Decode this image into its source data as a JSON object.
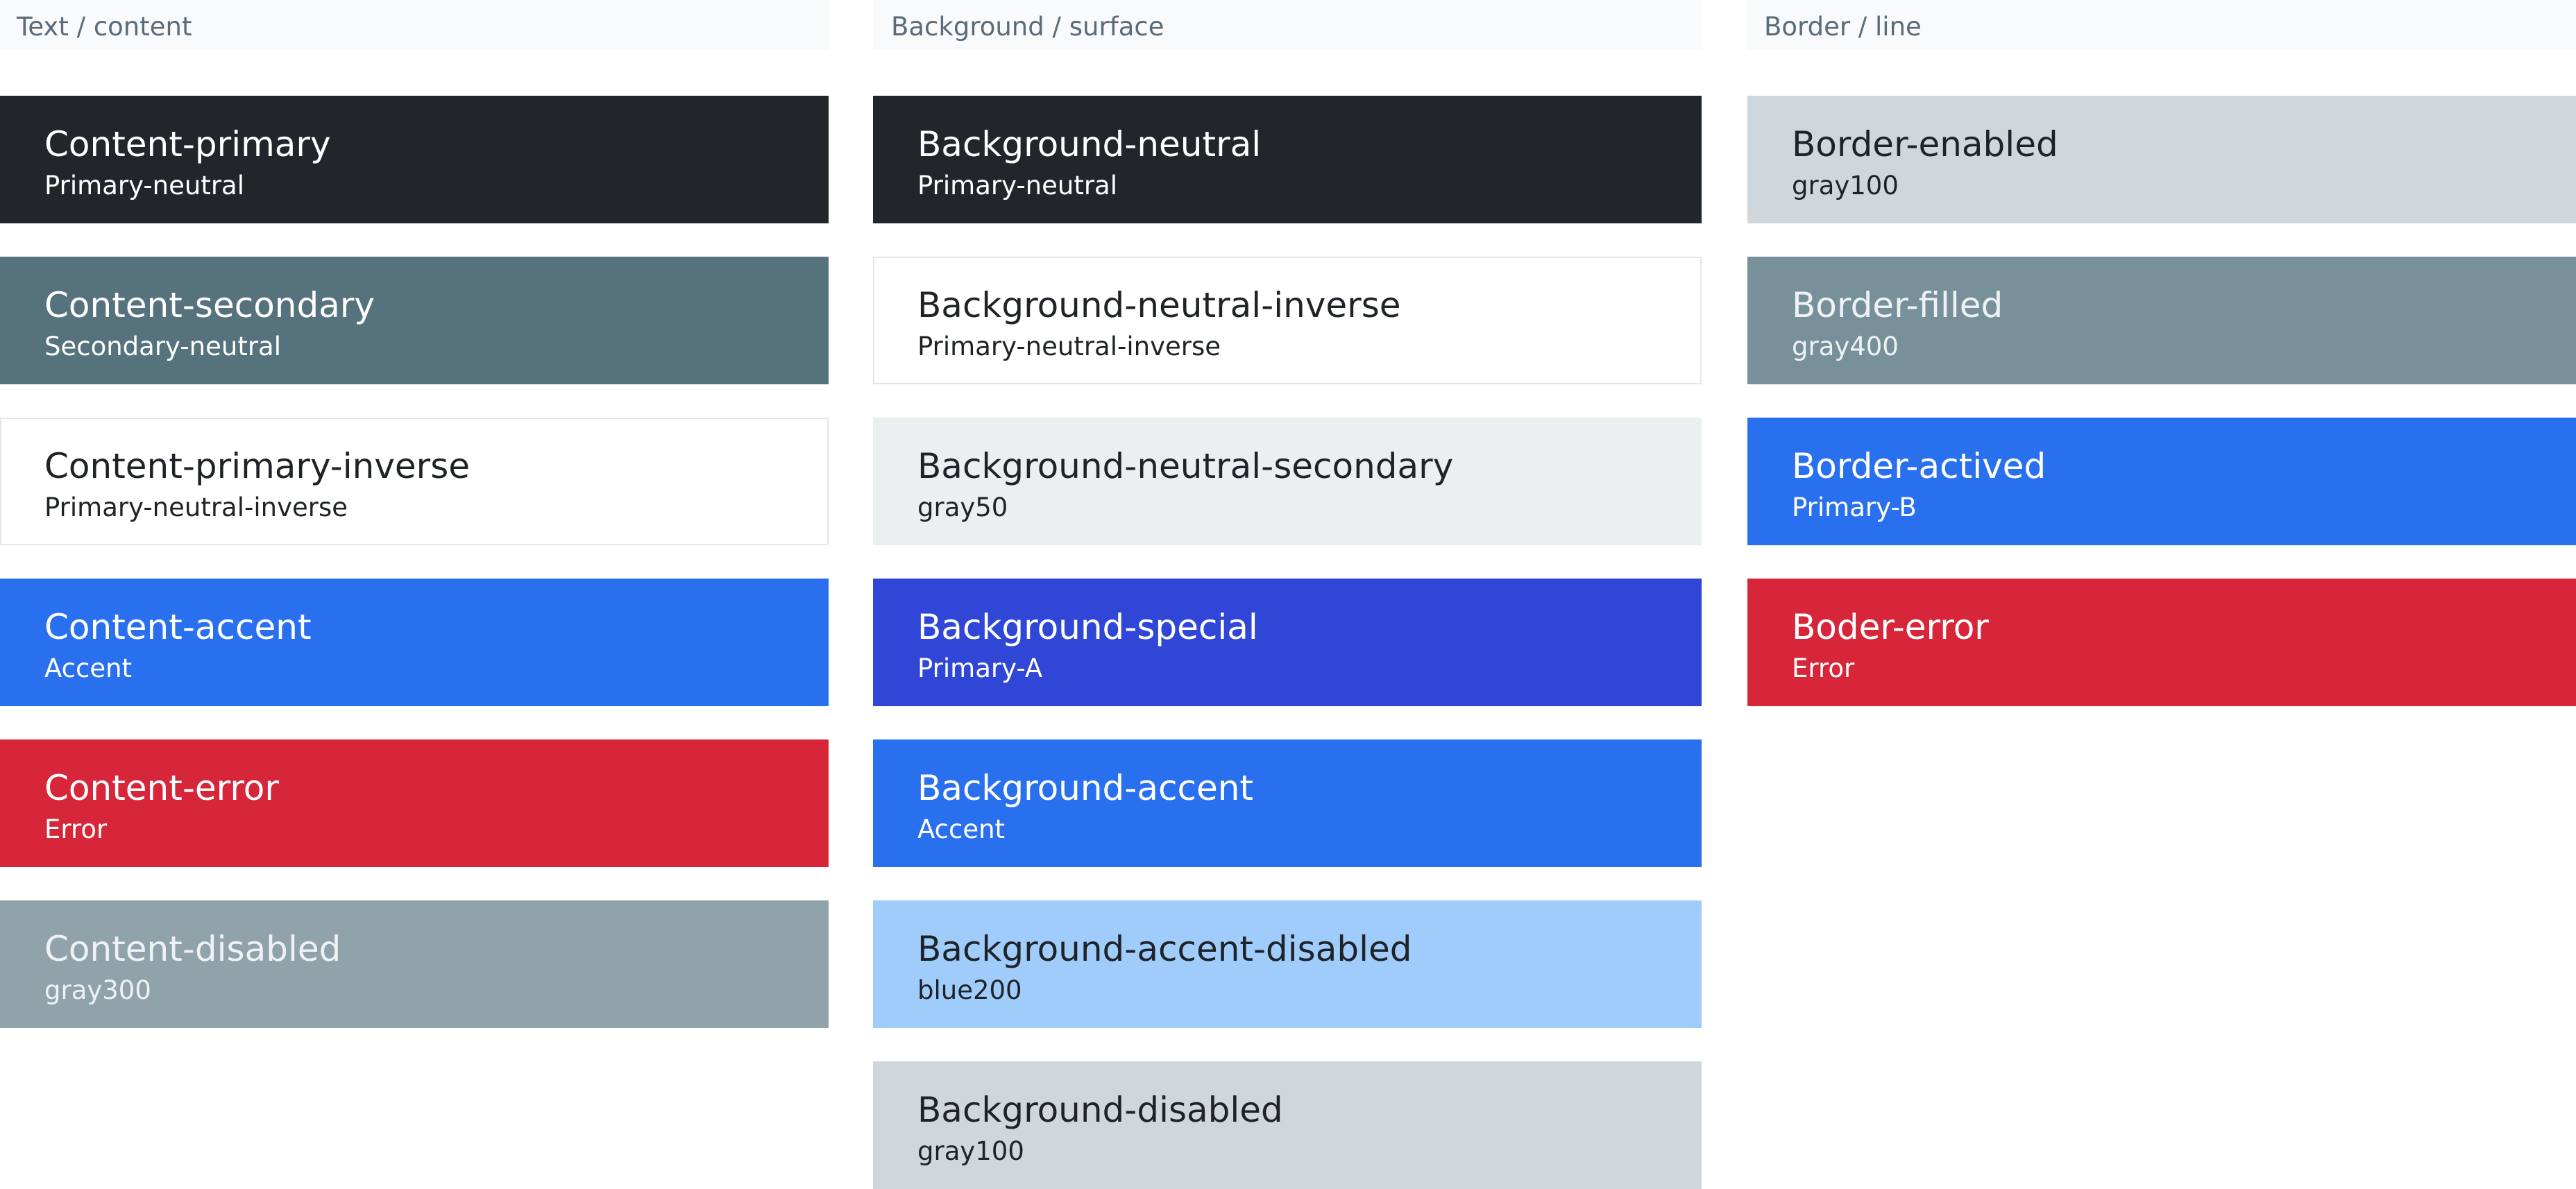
{
  "columns": [
    {
      "title": "Text / content",
      "swatches": [
        {
          "name": "Content-primary",
          "token": "Primary-neutral",
          "bg": "#22262b",
          "fg": "#ffffff",
          "bordered": false
        },
        {
          "name": "Content-secondary",
          "token": "Secondary-neutral",
          "bg": "#56727c",
          "fg": "#ffffff",
          "bordered": false
        },
        {
          "name": "Content-primary-inverse",
          "token": "Primary-neutral-inverse",
          "bg": "#ffffff",
          "fg": "#1f2328",
          "bordered": true
        },
        {
          "name": "Content-accent",
          "token": "Accent",
          "bg": "#2970ef",
          "fg": "#ffffff",
          "bordered": false
        },
        {
          "name": "Content-error",
          "token": "Error",
          "bg": "#d72539",
          "fg": "#ffffff",
          "bordered": false
        },
        {
          "name": "Content-disabled",
          "token": "gray300",
          "bg": "#90a3ab",
          "fg": "#eef2f4",
          "bordered": false
        }
      ]
    },
    {
      "title": "Background / surface",
      "swatches": [
        {
          "name": "Background-neutral",
          "token": "Primary-neutral",
          "bg": "#22262b",
          "fg": "#ffffff",
          "bordered": false
        },
        {
          "name": "Background-neutral-inverse",
          "token": "Primary-neutral-inverse",
          "bg": "#ffffff",
          "fg": "#1f2328",
          "bordered": true
        },
        {
          "name": "Background-neutral-secondary",
          "token": "gray50",
          "bg": "#eceff0",
          "fg": "#1f2328",
          "bordered": false
        },
        {
          "name": "Background-special",
          "token": "Primary-A",
          "bg": "#3046d6",
          "fg": "#ffffff",
          "bordered": false
        },
        {
          "name": "Background-accent",
          "token": "Accent",
          "bg": "#2970ef",
          "fg": "#ffffff",
          "bordered": false
        },
        {
          "name": "Background-accent-disabled",
          "token": "blue200",
          "bg": "#a0ccfc",
          "fg": "#1f2328",
          "bordered": false
        },
        {
          "name": "Background-disabled",
          "token": "gray100",
          "bg": "#d0d7dc",
          "fg": "#1f2328",
          "bordered": false
        }
      ]
    },
    {
      "title": "Border / line",
      "swatches": [
        {
          "name": "Border-enabled",
          "token": "gray100",
          "bg": "#d0d7dc",
          "fg": "#1f2328",
          "bordered": false
        },
        {
          "name": "Border-filled",
          "token": "gray400",
          "bg": "#78909a",
          "fg": "#eef2f4",
          "bordered": false
        },
        {
          "name": "Border-actived",
          "token": "Primary-B",
          "bg": "#2970ef",
          "fg": "#ffffff",
          "bordered": false
        },
        {
          "name": "Boder-error",
          "token": "Error",
          "bg": "#d72539",
          "fg": "#ffffff",
          "bordered": false
        }
      ]
    }
  ]
}
